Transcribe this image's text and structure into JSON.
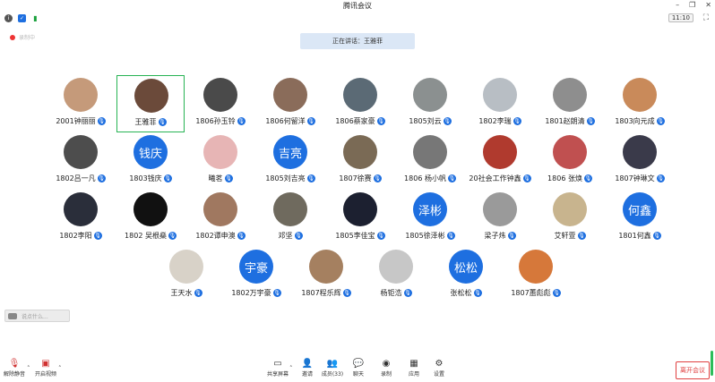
{
  "window": {
    "title": "腾讯会议"
  },
  "topbar": {
    "timer": "11:10"
  },
  "recording_label": "录制中",
  "speaking": "正在讲话：王雅菲",
  "participants": [
    {
      "name": "2001钟丽丽",
      "avatar": "photo",
      "color": "#c59a7a"
    },
    {
      "name": "王雅菲",
      "avatar": "photo",
      "color": "#6b4a3a",
      "selected": true
    },
    {
      "name": "1806孙玉铃",
      "avatar": "photo",
      "color": "#4a4a4a"
    },
    {
      "name": "1806何留洋",
      "avatar": "photo",
      "color": "#8a6c5a"
    },
    {
      "name": "1806蔡家豪",
      "avatar": "photo",
      "color": "#5b6a75"
    },
    {
      "name": "1805刘云",
      "avatar": "photo",
      "color": "#8b9090"
    },
    {
      "name": "1802李瑞",
      "avatar": "photo",
      "color": "#b8bec4"
    },
    {
      "name": "1801赵朗清",
      "avatar": "photo",
      "color": "#8e8e8e"
    },
    {
      "name": "1803向元成",
      "avatar": "photo",
      "color": "#c98a5a"
    },
    {
      "name": "1802吕一凡",
      "avatar": "photo",
      "color": "#4d4d4d"
    },
    {
      "name": "1803钱庆",
      "avatar": "text",
      "text": "钱庆"
    },
    {
      "name": "曦茗",
      "avatar": "photo",
      "color": "#e7b5b5"
    },
    {
      "name": "1805刘吉亮",
      "avatar": "text",
      "text": "吉亮"
    },
    {
      "name": "1807徐赛",
      "avatar": "photo",
      "color": "#7a6a55"
    },
    {
      "name": "1806 杨小帆",
      "avatar": "photo",
      "color": "#777777"
    },
    {
      "name": "20社会工作钟鑫",
      "avatar": "photo",
      "color": "#b03a2e"
    },
    {
      "name": "1806 张焕",
      "avatar": "photo",
      "color": "#c05050"
    },
    {
      "name": "1807钟琳文",
      "avatar": "photo",
      "color": "#3a3a4a"
    },
    {
      "name": "1802李阳",
      "avatar": "photo",
      "color": "#2a2e3a"
    },
    {
      "name": "1802 吴根燊",
      "avatar": "photo",
      "color": "#111111"
    },
    {
      "name": "1802谭申澳",
      "avatar": "photo",
      "color": "#a07860"
    },
    {
      "name": "邓坚",
      "avatar": "photo",
      "color": "#6f6a5e"
    },
    {
      "name": "1805李佳宝",
      "avatar": "photo",
      "color": "#1c2030"
    },
    {
      "name": "1805徐泽彬",
      "avatar": "text",
      "text": "泽彬"
    },
    {
      "name": "梁子炜",
      "avatar": "photo",
      "color": "#9a9a9a"
    },
    {
      "name": "艾轩萱",
      "avatar": "photo",
      "color": "#c8b48e"
    },
    {
      "name": "1801何鑫",
      "avatar": "text",
      "text": "何鑫"
    },
    {
      "name": "王天水",
      "avatar": "photo",
      "color": "#d8d2c8"
    },
    {
      "name": "1802万宇豪",
      "avatar": "text",
      "text": "宇豪"
    },
    {
      "name": "1807程乐辉",
      "avatar": "photo",
      "color": "#a58060"
    },
    {
      "name": "杨钜浩",
      "avatar": "photo",
      "color": "#c7c7c7"
    },
    {
      "name": "张松松",
      "avatar": "text",
      "text": "松松"
    },
    {
      "name": "1807蕙彪彪",
      "avatar": "photo",
      "color": "#d6783a"
    }
  ],
  "chat_placeholder": "说点什么...",
  "toolbar": {
    "mute": {
      "label": "解除静音",
      "icon": "mic-muted-icon"
    },
    "video": {
      "label": "开启视频",
      "icon": "camera-off-icon"
    },
    "share": {
      "label": "共享屏幕",
      "icon": "screen-share-icon"
    },
    "invite": {
      "label": "邀请",
      "icon": "add-user-icon"
    },
    "members": {
      "label": "成员(33)",
      "icon": "members-icon"
    },
    "chat": {
      "label": "聊天",
      "icon": "chat-icon"
    },
    "record": {
      "label": "录制",
      "icon": "record-icon"
    },
    "apps": {
      "label": "应用",
      "icon": "apps-icon"
    },
    "settings": {
      "label": "设置",
      "icon": "gear-icon"
    },
    "leave": "离开会议"
  }
}
